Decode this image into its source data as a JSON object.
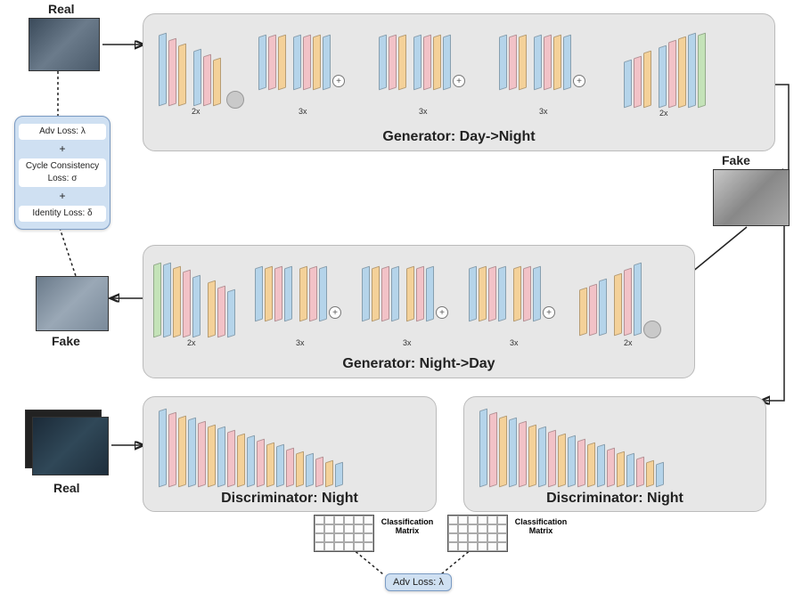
{
  "diagram_type": "CycleGAN architecture",
  "images": {
    "real_day": {
      "label": "Real"
    },
    "fake_night": {
      "label": "Fake"
    },
    "fake_day": {
      "label": "Fake"
    },
    "real_night": {
      "label": "Real"
    }
  },
  "modules": {
    "gen_day2night": {
      "title": "Generator: Day->Night",
      "blocks": [
        {
          "group": "enc",
          "mult": "2x"
        },
        {
          "group": "res",
          "mult": "3x"
        },
        {
          "group": "res",
          "mult": "3x"
        },
        {
          "group": "res",
          "mult": "3x"
        },
        {
          "group": "dec",
          "mult": "2x"
        }
      ]
    },
    "gen_night2day": {
      "title": "Generator: Night->Day",
      "blocks_mult": [
        "2x",
        "3x",
        "3x",
        "3x",
        "2x"
      ]
    },
    "disc_left": {
      "title": "Discriminator: Night"
    },
    "disc_right": {
      "title": "Discriminator: Night"
    }
  },
  "losses": {
    "combined": {
      "adv": "Adv Loss: λ",
      "cycle": "Cycle Consistency Loss: σ",
      "identity": "Identity Loss: δ",
      "plus": "+"
    },
    "adv_only": "Adv Loss: λ"
  },
  "classification": {
    "label": "Classification Matrix"
  },
  "layer_colors": {
    "conv": "blue",
    "norm": "pink",
    "activation": "orange",
    "output": "green"
  }
}
